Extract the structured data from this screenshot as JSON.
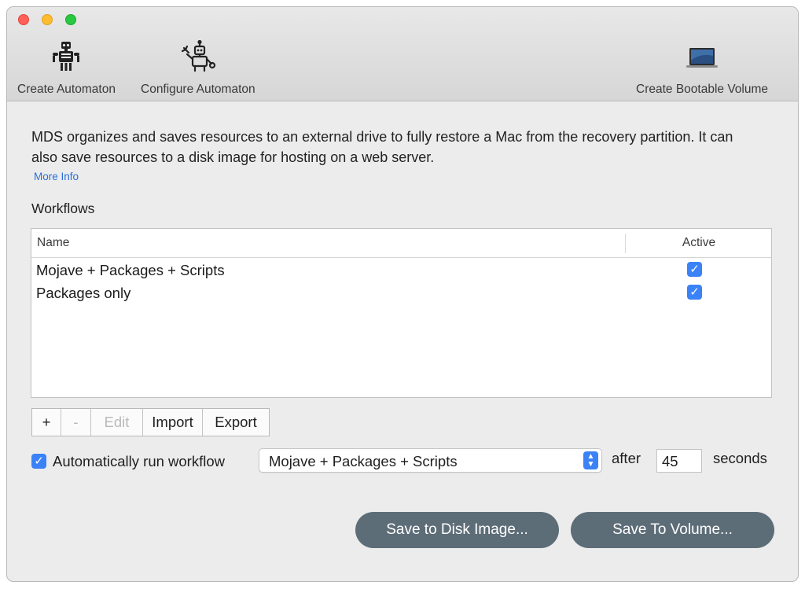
{
  "toolbar": {
    "items": [
      {
        "label": "Create Automaton",
        "icon": "robot-icon"
      },
      {
        "label": "Configure Automaton",
        "icon": "robot-wrench-icon"
      },
      {
        "label": "Create Bootable Volume",
        "icon": "laptop-icon"
      }
    ]
  },
  "description": "MDS organizes and saves resources to an external drive to fully restore a Mac from the recovery partition. It can also save resources to a disk image for hosting on a web server.",
  "more_info": "More Info",
  "workflows": {
    "title": "Workflows",
    "columns": [
      "Name",
      "Active"
    ],
    "rows": [
      {
        "name": "Mojave + Packages + Scripts",
        "active": true
      },
      {
        "name": "Packages only",
        "active": true
      }
    ]
  },
  "buttons": {
    "add": "+",
    "remove": "-",
    "edit": "Edit",
    "import": "Import",
    "export": "Export"
  },
  "auto_run": {
    "checked": true,
    "label": "Automatically run workflow",
    "selected": "Mojave + Packages + Scripts",
    "after": "after",
    "seconds_value": "45",
    "seconds": "seconds"
  },
  "actions": {
    "save_disk": "Save to Disk Image...",
    "save_volume": "Save To Volume..."
  },
  "colors": {
    "accent": "#3b82f6",
    "pill": "#5d6d78",
    "link": "#2a6fd6"
  }
}
